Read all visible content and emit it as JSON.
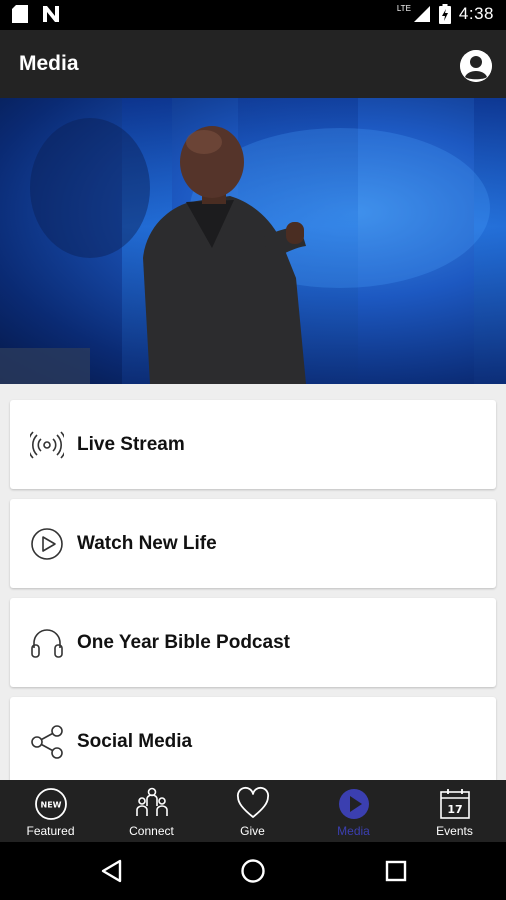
{
  "status_bar": {
    "time": "4:38",
    "network": "LTE"
  },
  "app_bar": {
    "title": "Media"
  },
  "menu": [
    {
      "label": "Live Stream",
      "icon": "live-stream-icon"
    },
    {
      "label": "Watch New Life",
      "icon": "play-circle-icon"
    },
    {
      "label": "One Year Bible Podcast",
      "icon": "headphones-icon"
    },
    {
      "label": "Social Media",
      "icon": "share-icon"
    }
  ],
  "bottom_nav": [
    {
      "label": "Featured",
      "icon": "new-badge-icon",
      "active": false
    },
    {
      "label": "Connect",
      "icon": "people-icon",
      "active": false
    },
    {
      "label": "Give",
      "icon": "heart-icon",
      "active": false
    },
    {
      "label": "Media",
      "icon": "play-circle-icon",
      "active": true
    },
    {
      "label": "Events",
      "icon": "calendar-icon",
      "active": false,
      "calendar_day": "17"
    }
  ],
  "colors": {
    "active_nav": "#3b3fb0",
    "app_bar": "#232323",
    "nav_bg": "#222222"
  }
}
